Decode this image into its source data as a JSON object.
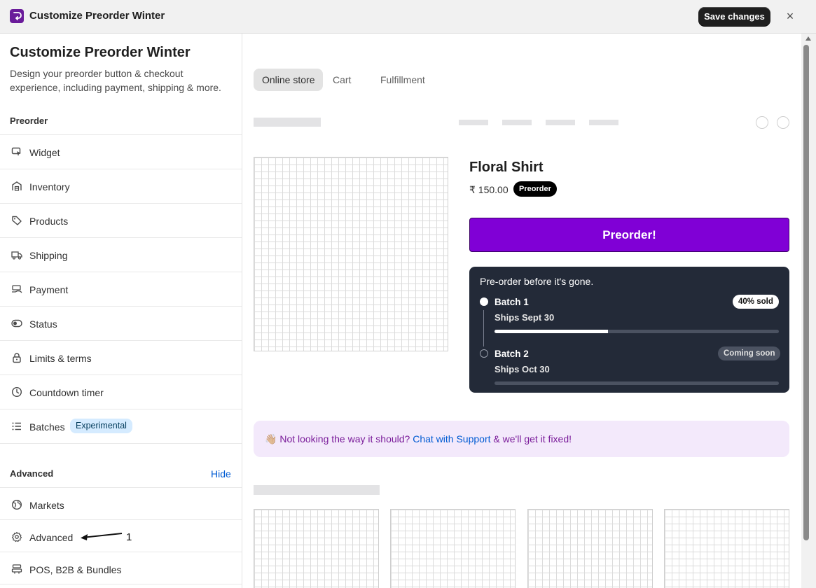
{
  "window": {
    "title": "Customize Preorder Winter",
    "save_label": "Save changes",
    "close_glyph": "×"
  },
  "sidebar": {
    "title": "Customize Preorder Winter",
    "description": "Design your preorder button & checkout experience, including payment, shipping & more.",
    "preorder_heading": "Preorder",
    "preorder_items": [
      {
        "label": "Widget",
        "icon": "cursor-pointer-icon"
      },
      {
        "label": "Inventory",
        "icon": "warehouse-icon"
      },
      {
        "label": "Products",
        "icon": "tag-icon"
      },
      {
        "label": "Shipping",
        "icon": "truck-icon"
      },
      {
        "label": "Payment",
        "icon": "hand-cash-icon"
      },
      {
        "label": "Status",
        "icon": "toggle-icon"
      },
      {
        "label": "Limits & terms",
        "icon": "lock-icon"
      },
      {
        "label": "Countdown timer",
        "icon": "clock-icon"
      },
      {
        "label": "Batches",
        "icon": "list-icon",
        "badge": "Experimental"
      }
    ],
    "advanced_heading": "Advanced",
    "hide_label": "Hide",
    "advanced_items": [
      {
        "label": "Markets",
        "icon": "globe-icon"
      },
      {
        "label": "Advanced",
        "icon": "gear-icon"
      },
      {
        "label": "POS, B2B & Bundles",
        "icon": "store-stack-icon"
      }
    ],
    "annotation_number": "1"
  },
  "main": {
    "tabs": [
      {
        "label": "Online store",
        "active": true
      },
      {
        "label": "Cart",
        "active": false
      },
      {
        "label": "Fulfillment",
        "active": false
      }
    ],
    "product": {
      "title": "Floral Shirt",
      "price": "₹ 150.00",
      "badge": "Preorder",
      "button_label": "Preorder!"
    },
    "batches": {
      "heading": "Pre-order before it's gone.",
      "items": [
        {
          "name": "Batch 1",
          "ships": "Ships Sept 30",
          "status": "40% sold",
          "progress": 0.4
        },
        {
          "name": "Batch 2",
          "ships": "Ships Oct 30",
          "status": "Coming soon",
          "progress": 0
        }
      ]
    },
    "notice": {
      "emoji": "👋🏼",
      "text_before": "Not looking the way it should?",
      "link": "Chat with Support",
      "text_after": "& we'll get it fixed!"
    }
  },
  "colors": {
    "accent": "#8000d6",
    "card_bg": "#232a38",
    "link": "#005bd3",
    "notice_bg": "#f3e9fb"
  }
}
